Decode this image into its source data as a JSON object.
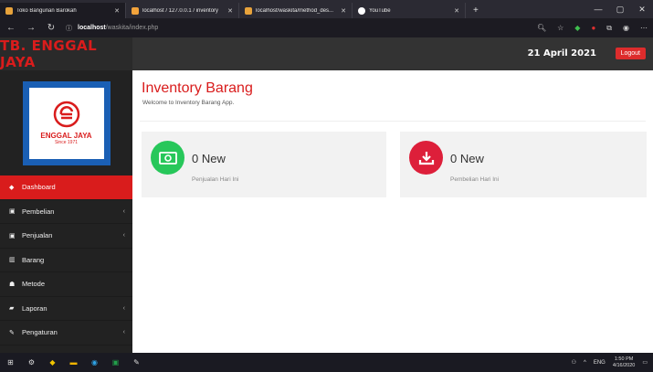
{
  "browser": {
    "tabs": [
      {
        "title": "Toko Bangunan Barokah",
        "active": true,
        "color": "#e8a33b"
      },
      {
        "title": "localhost / 127.0.0.1 / inventory",
        "active": false,
        "color": "#f2a33b"
      },
      {
        "title": "localhost/waskita/method_des...",
        "active": false,
        "color": "#e8a33b"
      },
      {
        "title": "YouTube",
        "active": false,
        "color": "#ffffff"
      }
    ],
    "url_host": "localhost",
    "url_path": "/waskita/index.php"
  },
  "header": {
    "brand": "TB. ENGGAL JAYA",
    "date": "21 April 2021",
    "logout_label": "Logout"
  },
  "logo": {
    "name": "ENGGAL JAYA",
    "since": "Since 1971"
  },
  "sidebar": {
    "items": [
      {
        "label": "Dashboard",
        "icon": "dashboard-icon",
        "glyph": "◆",
        "active": true,
        "caret": false
      },
      {
        "label": "Pembelian",
        "icon": "money-icon",
        "glyph": "▣",
        "active": false,
        "caret": true
      },
      {
        "label": "Penjualan",
        "icon": "money-icon",
        "glyph": "▣",
        "active": false,
        "caret": true
      },
      {
        "label": "Barang",
        "icon": "barcode-icon",
        "glyph": "▥",
        "active": false,
        "caret": false
      },
      {
        "label": "Metode",
        "icon": "users-icon",
        "glyph": "☗",
        "active": false,
        "caret": false
      },
      {
        "label": "Laporan",
        "icon": "book-icon",
        "glyph": "▰",
        "active": false,
        "caret": true
      },
      {
        "label": "Pengaturan",
        "icon": "wrench-icon",
        "glyph": "✎",
        "active": false,
        "caret": true
      }
    ]
  },
  "main": {
    "title": "Inventory Barang",
    "subtitle": "Welcome to Inventory Barang App.",
    "cards": [
      {
        "value": "0 New",
        "label": "Penjualan Hari Ini",
        "icon": "money-bill-icon",
        "color": "#27c75a"
      },
      {
        "value": "0 New",
        "label": "Pembelian Hari Ini",
        "icon": "download-icon",
        "color": "#dd1f3a"
      }
    ]
  },
  "taskbar": {
    "lang": "ENG",
    "time": "1:50 PM",
    "date": "4/16/2020"
  },
  "colors": {
    "accent": "#d91c1c",
    "sidebar_bg": "#222222",
    "header_bg": "#2a2a2a"
  }
}
